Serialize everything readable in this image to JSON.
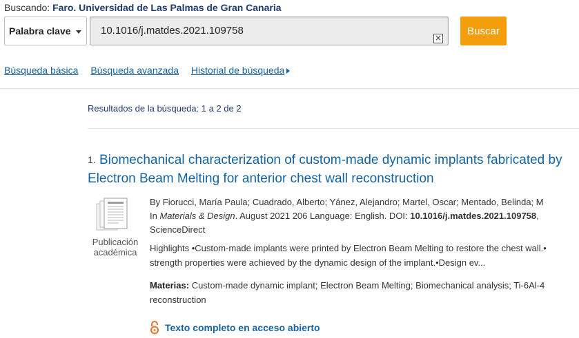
{
  "header": {
    "searching_label": "Buscando:",
    "database_name": "Faro. Universidad de Las Palmas de Gran Canaria",
    "field_select": "Palabra clave",
    "query": "10.1016/j.matdes.2021.109758",
    "clear_glyph": "×",
    "search_button": "Buscar"
  },
  "nav": {
    "basic": "Búsqueda básica",
    "advanced": "Búsqueda avanzada",
    "history": "Historial de búsqueda"
  },
  "results": {
    "summary": "Resultados de la búsqueda: 1 a 2 de 2",
    "items": [
      {
        "number": "1.",
        "title": "Biomechanical characterization of custom-made dynamic implants fabricated by Electron Beam Melting for anterior chest wall reconstruction",
        "doc_type": "Publicación académica",
        "authors_line": "By Fiorucci, María Paula; Cuadrado, Alberto; Yánez, Alejandro; Martel, Oscar; Mentado, Belinda; M",
        "source_prefix": "In ",
        "journal": "Materials & Design",
        "source_rest": ". August 2021 206 Language: English. DOI: ",
        "doi": "10.1016/j.matdes.2021.109758",
        "doi_suffix": ",",
        "provider": "ScienceDirect",
        "abstract_line1": "Highlights •Custom-made implants were printed by Electron Beam Melting to restore the chest wall.•",
        "abstract_line2": "strength properties were achieved by the dynamic design of the implant.•Design ev...",
        "subjects_label": "Materias:",
        "subjects_line1": " Custom-made dynamic implant; Electron Beam Melting; Biomechanical analysis; Ti-6Al-4",
        "subjects_line2": "reconstruction",
        "open_access_link": "Texto completo en acceso abierto"
      }
    ]
  },
  "colors": {
    "link": "#1463a0",
    "search_button": "#f59e0c",
    "database_name": "#1e3a6b",
    "open_access_icon": "#e8712a"
  },
  "icons": [
    "clear-icon",
    "caret-down-icon",
    "chevron-right-icon",
    "document-icon",
    "open-access-lock-icon"
  ]
}
